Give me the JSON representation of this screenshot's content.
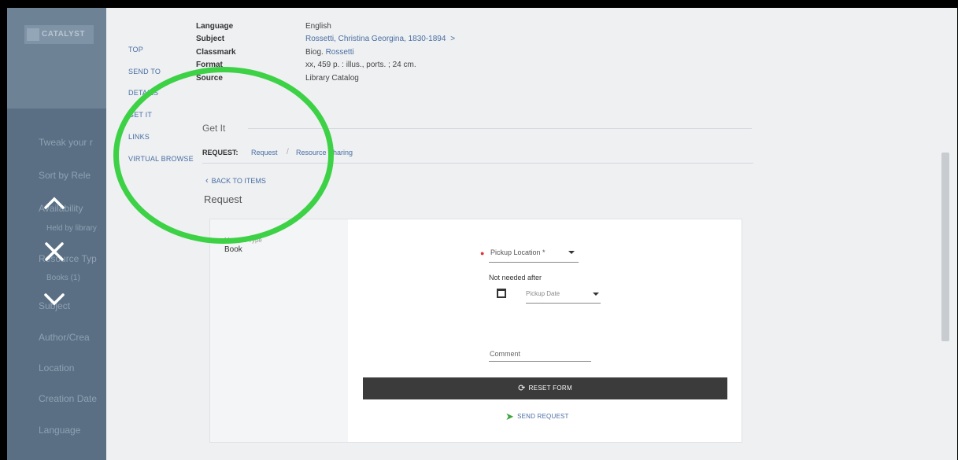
{
  "left_panel": {
    "logo": "CATALYST",
    "faded_items": [
      "Tweak your r",
      "Sort by  Rele",
      "Availability",
      "Held by library",
      "Resource Typ",
      "Books (1)",
      "Subject",
      "Author/Crea",
      "Location",
      "Creation Date",
      "Language"
    ]
  },
  "overlay_nav": {
    "up_icon": "chevron-up-icon",
    "close_icon": "close-icon",
    "down_icon": "chevron-down-icon"
  },
  "section_links": [
    "TOP",
    "SEND TO",
    "DETAILS",
    "GET IT",
    "LINKS",
    "VIRTUAL BROWSE"
  ],
  "details": {
    "language_label": "Language",
    "language_value": "English",
    "subject_label": "Subject",
    "subject_value": "Rossetti, Christina Georgina, 1830-1894",
    "subject_chevron": ">",
    "classmark_label": "Classmark",
    "classmark_prefix": "Biog.",
    "classmark_link": "Rossetti",
    "format_label": "Format",
    "format_value": "xx, 459 p. : illus., ports. ; 24 cm.",
    "source_label": "Source",
    "source_value": "Library Catalog"
  },
  "getit": {
    "heading": "Get It",
    "request_label": "REQUEST:",
    "request_link": "Request",
    "separator": "/",
    "resource_sharing_link": "Resource Sharing",
    "back_link": "BACK TO ITEMS",
    "request_title": "Request"
  },
  "form": {
    "material_type_label": "Material Type",
    "material_type_value": "Book",
    "pickup_location_label": "Pickup Location *",
    "not_needed_label": "Not needed after",
    "pickup_date_placeholder": "Pickup Date",
    "comment_placeholder": "Comment",
    "reset_label": "RESET FORM",
    "send_label": "SEND REQUEST"
  },
  "colors": {
    "annotation_circle": "#3dd146",
    "link": "#4a6ea3",
    "sidebar": "#5a6f84"
  }
}
